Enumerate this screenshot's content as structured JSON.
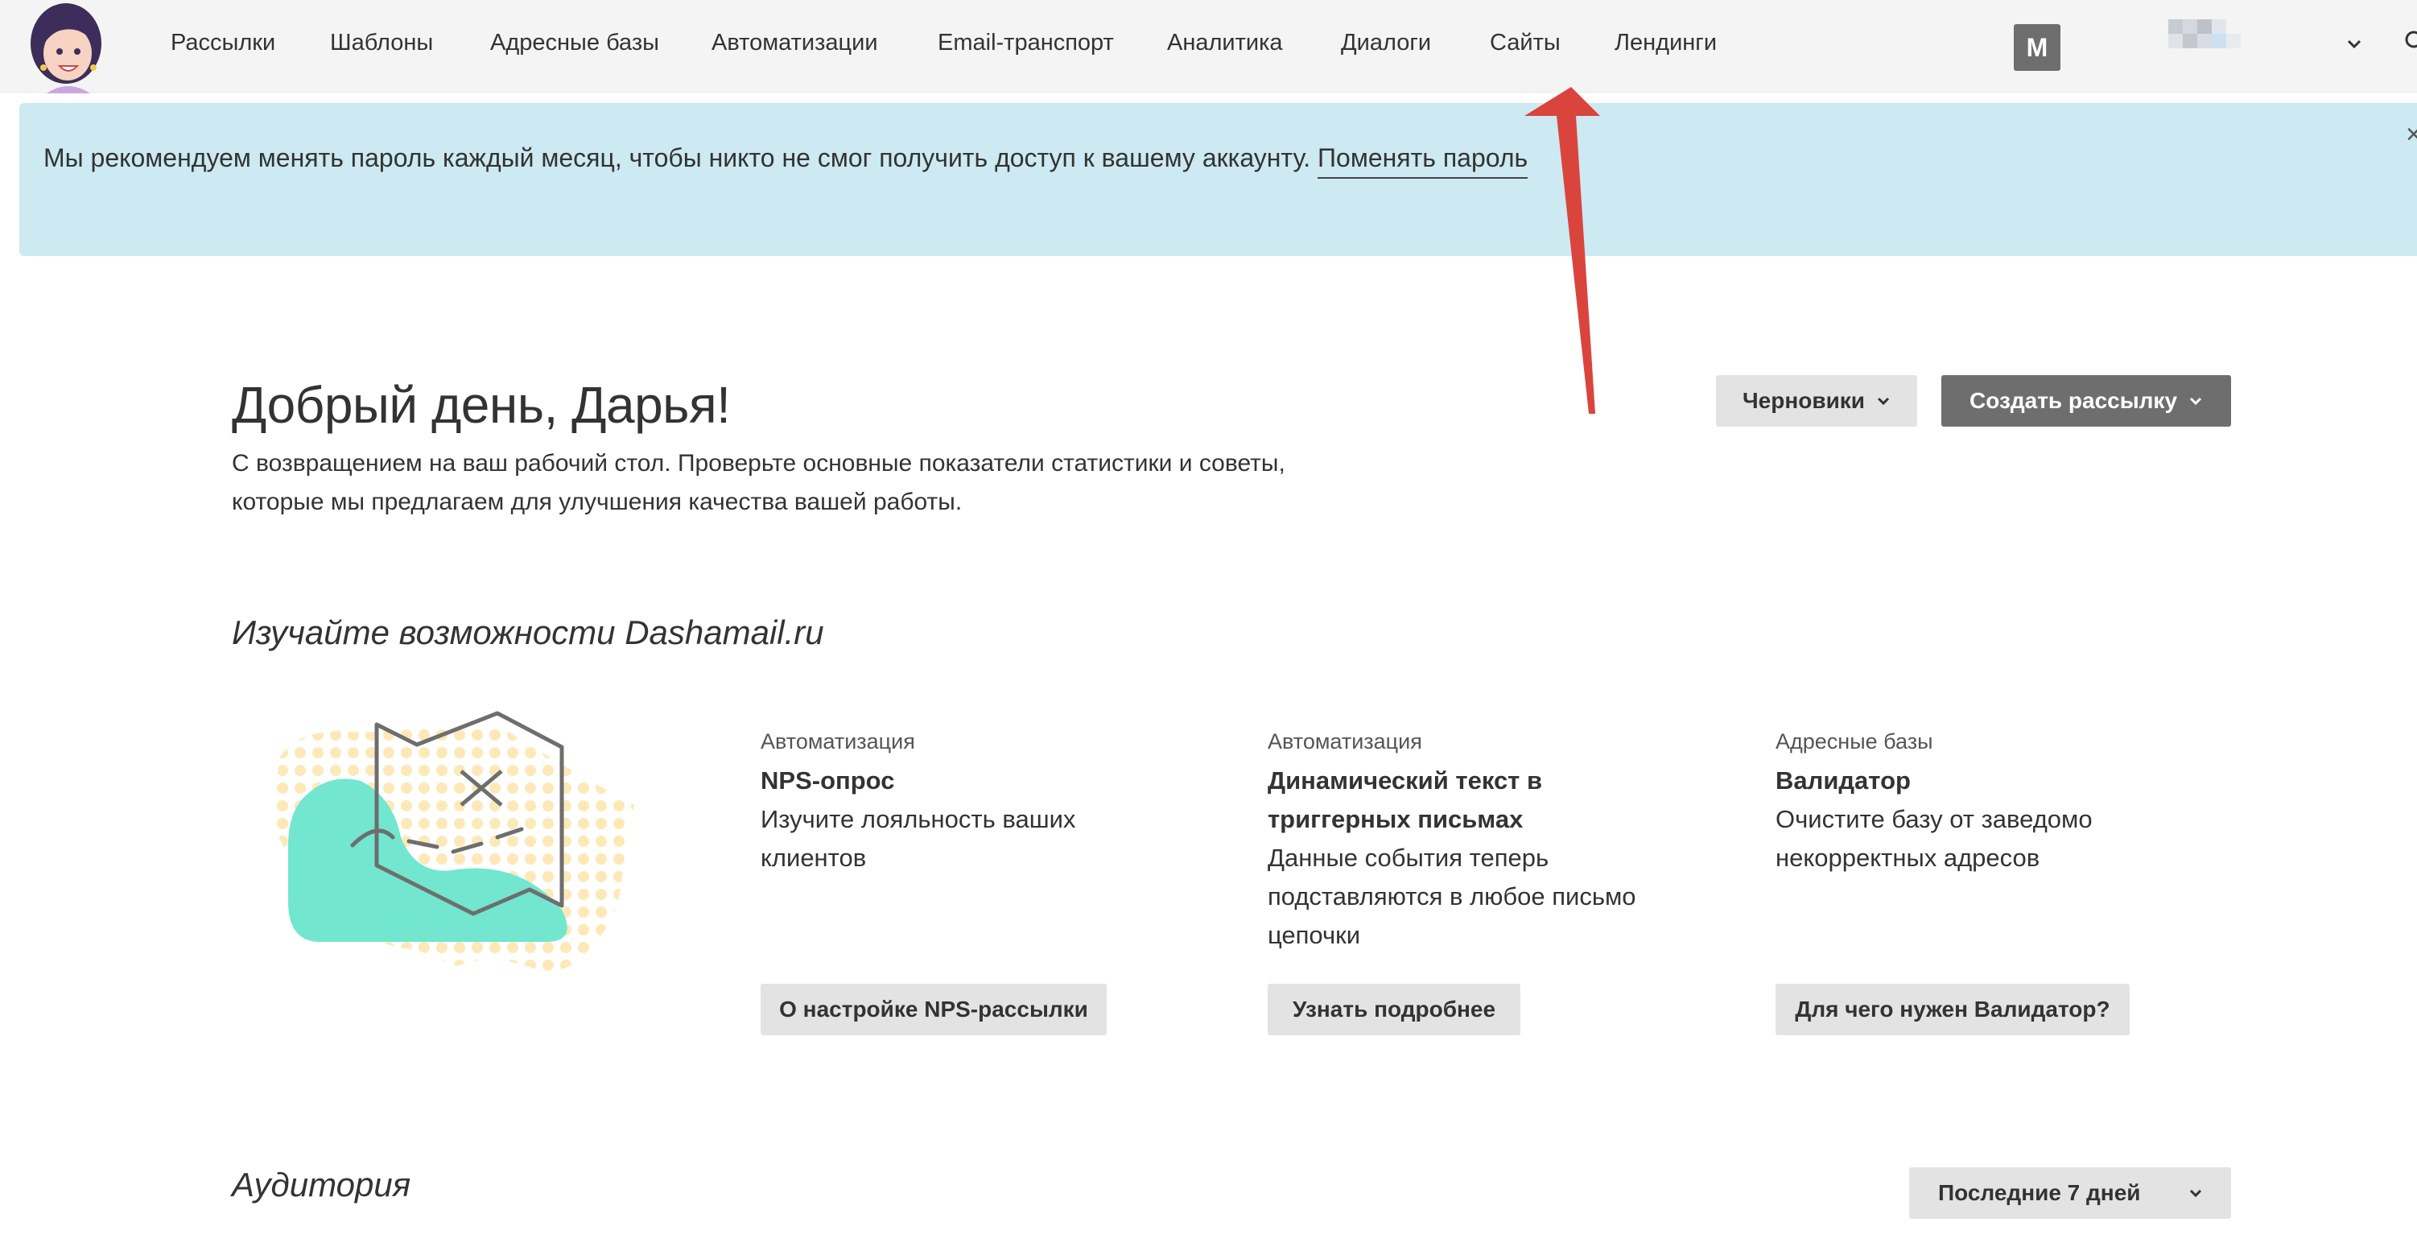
{
  "nav": {
    "items": [
      "Рассылки",
      "Шаблоны",
      "Адресные базы",
      "Автоматизации",
      "Email-транспорт",
      "Аналитика",
      "Диалоги",
      "Сайты",
      "Лендинги"
    ],
    "avatar_letter": "M"
  },
  "banner": {
    "text": "Мы рекомендуем менять пароль каждый месяц, чтобы никто не смог получить доступ к вашему аккаунту.",
    "link": "Поменять пароль",
    "close": "×"
  },
  "greeting": {
    "title": "Добрый день, Дарья!",
    "subtitle": "С возвращением на ваш рабочий стол. Проверьте основные показатели статистики и советы, которые мы предлагаем для улучшения качества вашей работы."
  },
  "actions": {
    "drafts": "Черновики",
    "create": "Создать рассылку"
  },
  "explore": {
    "title": "Изучайте возможности Dashamail.ru",
    "cards": [
      {
        "category": "Автоматизация",
        "title": "NPS-опрос",
        "desc": "Изучите лояльность ваших клиентов",
        "button": "О настройке NPS-рассылки"
      },
      {
        "category": "Автоматизация",
        "title": "Динамический текст в триггерных письмах",
        "desc": "Данные события теперь подставляются в любое письмо цепочки",
        "button": "Узнать подробнее"
      },
      {
        "category": "Адресные базы",
        "title": "Валидатор",
        "desc": "Очистите базу от заведомо некорректных адресов",
        "button": "Для чего нужен Валидатор?"
      }
    ]
  },
  "audience": {
    "title": "Аудитория",
    "period": "Последние 7 дней"
  },
  "colors": {
    "banner_bg": "#cde9f1",
    "primary_button": "#6e6e6e",
    "secondary_button": "#e3e3e3",
    "mint": "#72e6cf",
    "dots": "#fde9b8",
    "arrow": "#d9453d"
  }
}
